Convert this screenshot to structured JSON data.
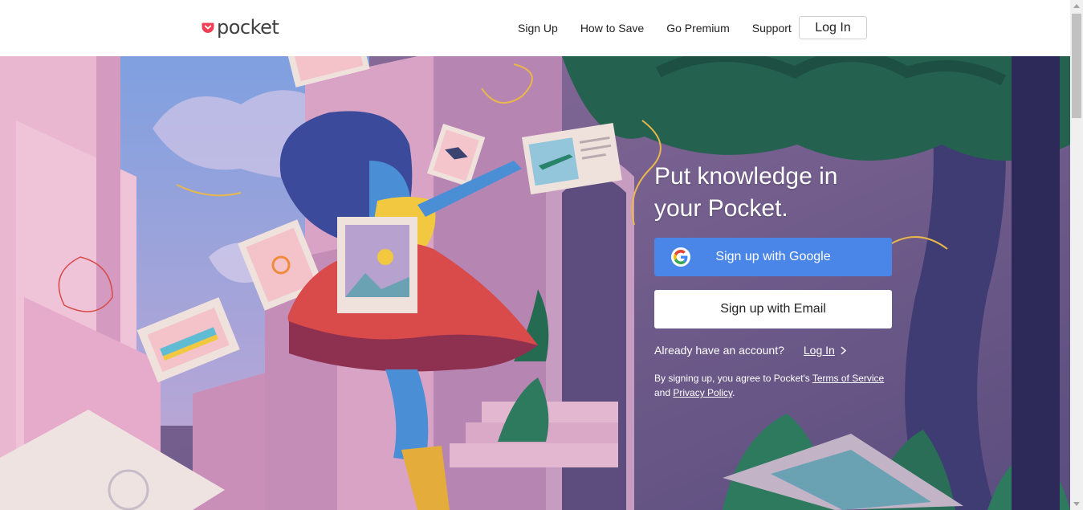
{
  "header": {
    "logo_text": "pocket",
    "nav": [
      {
        "label": "Sign Up"
      },
      {
        "label": "How to Save"
      },
      {
        "label": "Go Premium"
      },
      {
        "label": "Support"
      }
    ],
    "login_label": "Log In"
  },
  "hero": {
    "headline_line1": "Put knowledge in",
    "headline_line2": "your Pocket.",
    "google_button": "Sign up with Google",
    "email_button": "Sign up with Email",
    "already_text": "Already have an account?",
    "login_link": "Log In",
    "legal_prefix": "By signing up, you agree to Pocket's",
    "terms_link": "Terms of Service",
    "legal_and": "and",
    "privacy_link": "Privacy Policy",
    "legal_suffix": "."
  },
  "colors": {
    "brand_red": "#ef4056",
    "google_blue": "#4a86e8"
  }
}
